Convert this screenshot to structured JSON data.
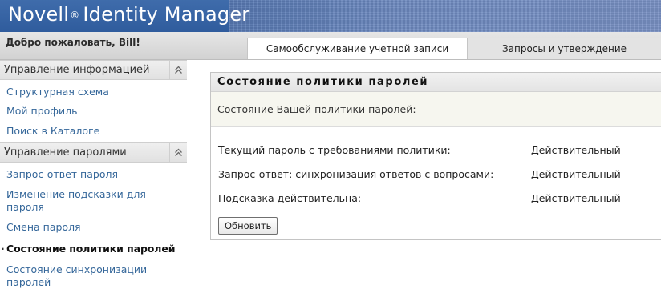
{
  "header": {
    "product_name": "Novell",
    "registered_mark": "®",
    "product_suffix": "Identity Manager"
  },
  "topbar": {
    "welcome": "Добро пожаловать, Bill!",
    "tabs": [
      {
        "label": "Самообслуживание учетной записи",
        "active": true
      },
      {
        "label": "Запросы и утверждение",
        "active": false
      }
    ]
  },
  "sidebar": {
    "sections": [
      {
        "title": "Управление информацией",
        "items": [
          {
            "label": "Структурная схема"
          },
          {
            "label": "Мой профиль"
          },
          {
            "label": "Поиск в Каталоге"
          }
        ]
      },
      {
        "title": "Управление паролями",
        "items": [
          {
            "label": "Запрос-ответ пароля"
          },
          {
            "label": "Изменение подсказки для пароля"
          },
          {
            "label": "Смена пароля"
          },
          {
            "label": "Состояние политики паролей",
            "current": true
          },
          {
            "label": "Состояние синхронизации паролей"
          }
        ]
      }
    ]
  },
  "panel": {
    "title": "Состояние политики паролей",
    "subtitle": "Состояние Вашей политики паролей:",
    "rows": [
      {
        "label": "Текущий пароль с требованиями политики:",
        "value": "Действительный"
      },
      {
        "label": "Запрос-ответ: синхронизация ответов с вопросами:",
        "value": "Действительный"
      },
      {
        "label": "Подсказка действительна:",
        "value": "Действительный"
      }
    ],
    "refresh_label": "Обновить"
  },
  "colors": {
    "header_blue": "#3a66a5",
    "link_blue": "#35679a",
    "subtitle_bg": "#f6f6ef"
  },
  "icons": {
    "collapse": "double-chevron-up-icon"
  }
}
